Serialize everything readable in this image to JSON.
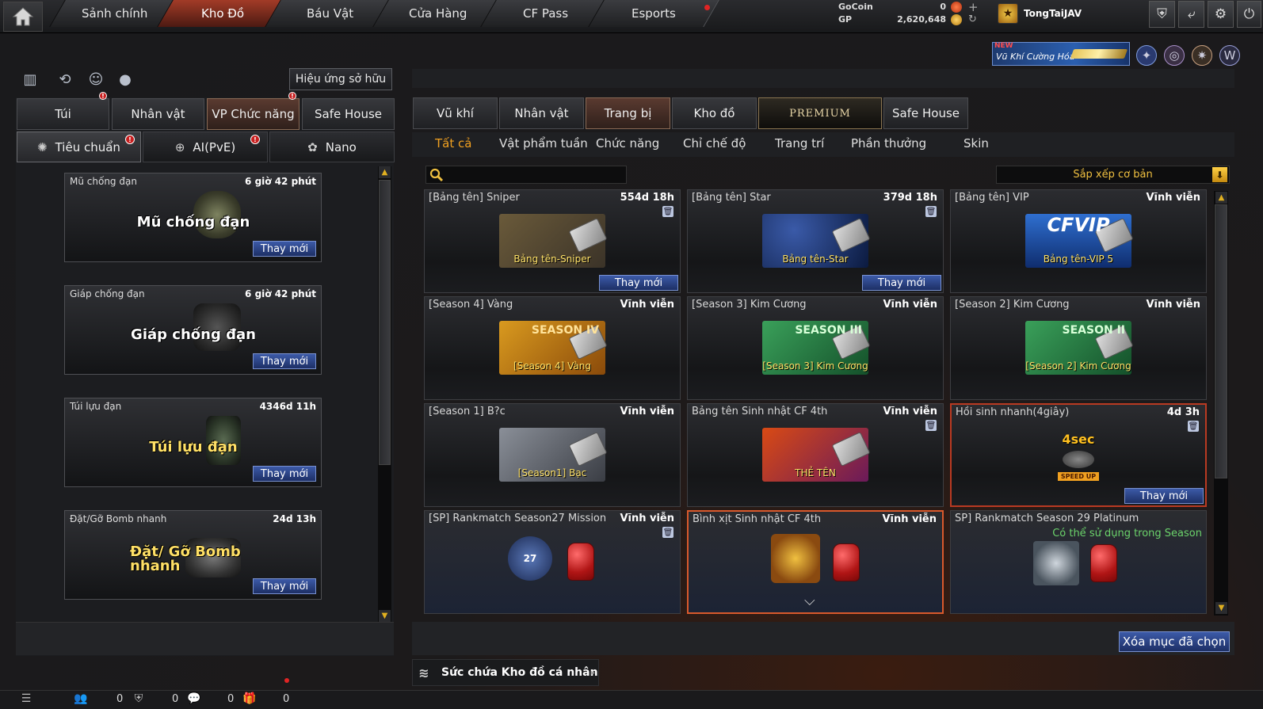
{
  "nav": {
    "tabs": [
      "Sảnh chính",
      "Kho Đồ",
      "Báu Vật",
      "Cửa Hàng",
      "CF Pass",
      "Esports"
    ],
    "active": "Kho Đồ"
  },
  "currency": {
    "gocoin_label": "GoCoin",
    "gocoin_value": "0",
    "gp_label": "GP",
    "gp_value": "2,620,648"
  },
  "user": {
    "name": "TongTaiJAV"
  },
  "banner": {
    "new_label": "NEW",
    "text": "Vũ Khí Cường Hóa"
  },
  "left": {
    "effect_button": "Hiệu ứng sở hữu",
    "tabs": [
      "Túi",
      "Nhân vật",
      "VP Chức năng",
      "Safe House"
    ],
    "subtabs": [
      "Tiêu chuẩn",
      "AI(PvE)",
      "Nano"
    ],
    "cards": [
      {
        "name": "Mũ chống đạn",
        "time": "6 giờ 42 phút",
        "art": "Mũ chống đạn",
        "button": "Thay mới"
      },
      {
        "name": "Giáp chống đạn",
        "time": "6 giờ 42 phút",
        "art": "Giáp chống đạn",
        "button": "Thay mới"
      },
      {
        "name": "Túi lựu đạn",
        "time": "4346d 11h",
        "art": "Túi lựu đạn",
        "button": "Thay mới"
      },
      {
        "name": "Đặt/Gỡ Bomb nhanh",
        "time": "24d 13h",
        "art": "Đặt/ Gỡ Bomb nhanh",
        "button": "Thay mới"
      }
    ]
  },
  "right": {
    "tabs": [
      "Vũ khí",
      "Nhân vật",
      "Trang bị",
      "Kho đồ",
      "PREMIUM",
      "Safe House"
    ],
    "subtabs": [
      "Tất cả",
      "Vật phẩm tuần",
      "Chức năng",
      "Chỉ chế độ",
      "Trang trí",
      "Phần thưởng",
      "Skin"
    ],
    "sort_label": "Sắp xếp cơ bản",
    "items": [
      {
        "name": "[Bảng tên] Sniper",
        "time": "554d 18h",
        "art": "Bảng tên-Sniper",
        "button": "Thay mới"
      },
      {
        "name": "[Bảng tên] Star",
        "time": "379d 18h",
        "art": "Bảng tên-Star",
        "button": "Thay mới"
      },
      {
        "name": "[Bảng tên] VIP",
        "time": "Vĩnh viễn",
        "art": "Bảng tên-VIP 5",
        "art_top": "CFVIP"
      },
      {
        "name": "[Season 4] Vàng",
        "time": "Vĩnh viễn",
        "art": "[Season 4] Vàng",
        "art_top": "SEASON IV"
      },
      {
        "name": "[Season 3] Kim Cương",
        "time": "Vĩnh viễn",
        "art": "[Season 3] Kim Cương",
        "art_top": "SEASON III"
      },
      {
        "name": "[Season 2] Kim Cương",
        "time": "Vĩnh viễn",
        "art": "[Season 2] Kim Cương",
        "art_top": "SEASON II"
      },
      {
        "name": "[Season 1] B?c",
        "time": "Vĩnh viễn",
        "art": "[Season1] Bạc"
      },
      {
        "name": "Bảng tên Sinh nhật CF 4th",
        "time": "Vĩnh viễn",
        "art": "THẺ TÊN"
      },
      {
        "name": "Hồi sinh nhanh(4giây)",
        "time": "4d 3h",
        "art_top": "4sec",
        "art": "SPEED UP",
        "button": "Thay mới"
      },
      {
        "name": "[SP] Rankmatch Season27 Mission",
        "time": "Vĩnh viễn",
        "art_top": "27"
      },
      {
        "name": "Bình xịt Sinh nhật CF 4th",
        "time": "Vĩnh viễn"
      },
      {
        "name": "SP] Rankmatch Season 29 Platinum",
        "note": "Có thể sử dụng trong Season"
      }
    ],
    "delete_button": "Xóa mục đã chọn",
    "capacity_label": "Sức chứa Kho đồ cá nhân"
  },
  "status": {
    "counts": [
      "0",
      "0",
      "0",
      "0"
    ]
  },
  "colors": {
    "accent_active_tab": "#a23b27",
    "button_blue": "#2f4a90",
    "highlight_orange": "#f0a020",
    "note_green": "#6bd36b"
  }
}
